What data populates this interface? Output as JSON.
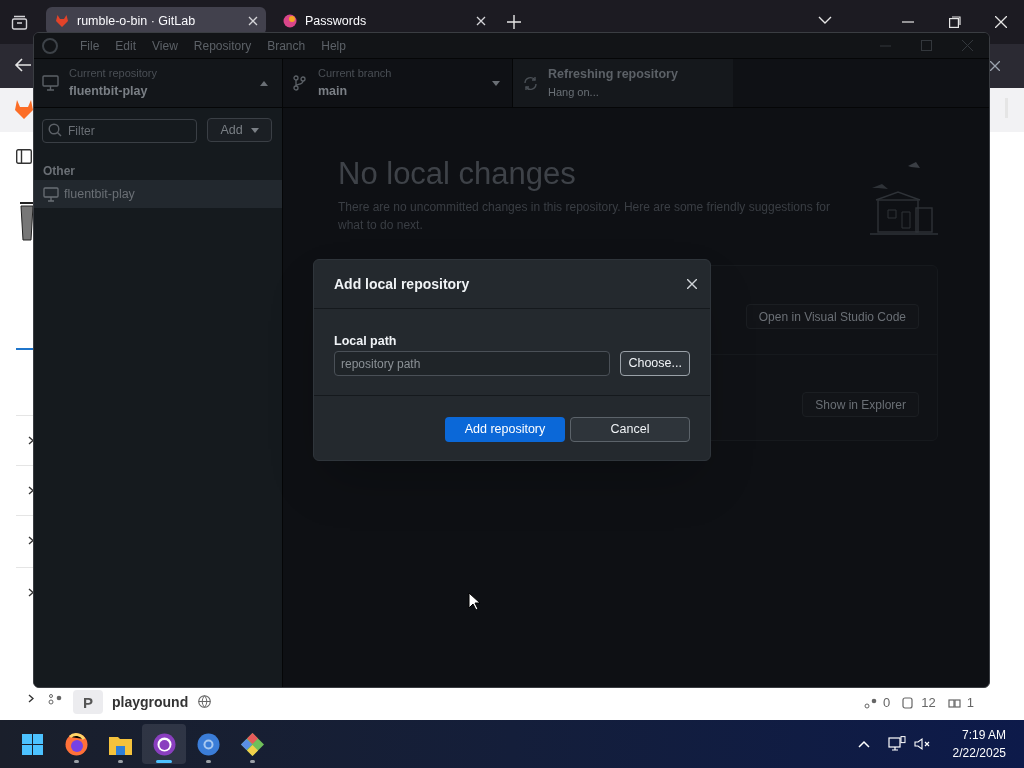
{
  "browser": {
    "tabs": [
      {
        "title": "rumble-o-bin · GitLab",
        "selected": true
      },
      {
        "title": "Passwords",
        "selected": false
      }
    ]
  },
  "page": {
    "project_row": {
      "avatar": "P",
      "name": "playground",
      "stats": [
        "0",
        "12",
        "1"
      ]
    }
  },
  "app": {
    "menu": [
      "File",
      "Edit",
      "View",
      "Repository",
      "Branch",
      "Help"
    ],
    "repository": {
      "label": "Current repository",
      "value": "fluentbit-play",
      "expanded": true
    },
    "branch": {
      "label": "Current branch",
      "value": "main"
    },
    "fetch": {
      "label": "Refreshing repository",
      "detail": "Hang on..."
    },
    "filter": {
      "placeholder": "Filter"
    },
    "add_button": "Add",
    "groups": [
      {
        "title": "Other",
        "items": [
          {
            "name": "fluentbit-play",
            "selected": true
          }
        ]
      }
    ],
    "changes": {
      "title": "No local changes",
      "description": "There are no uncommitted changes in this repository. Here are some friendly suggestions for what to do next.",
      "actions": [
        "Open in Visual Studio Code",
        "Show in Explorer"
      ]
    }
  },
  "dialog": {
    "title": "Add local repository",
    "field_label": "Local path",
    "placeholder": "repository path",
    "choose": "Choose...",
    "primary": "Add repository",
    "cancel": "Cancel"
  },
  "taskbar": {
    "apps": [
      {
        "kind": "start",
        "active": false
      },
      {
        "kind": "firefox",
        "active": false
      },
      {
        "kind": "folder",
        "active": false
      },
      {
        "kind": "github",
        "active": true
      },
      {
        "kind": "chromium",
        "active": false
      },
      {
        "kind": "git",
        "active": false
      }
    ],
    "time": "7:19 AM",
    "date": "2/22/2025"
  }
}
